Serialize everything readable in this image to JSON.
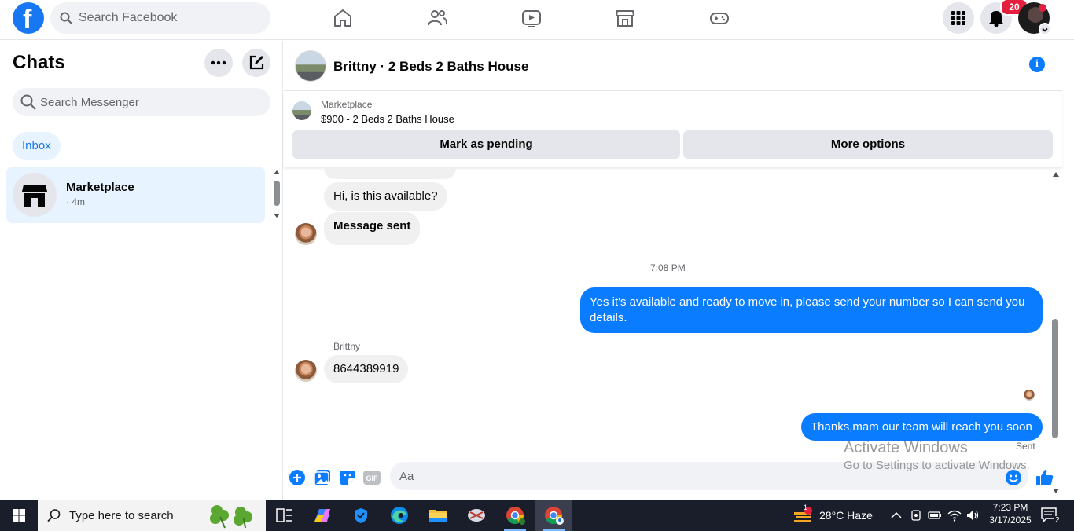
{
  "topbar": {
    "logo_letter": "f",
    "search_placeholder": "Search Facebook",
    "notifications_count": "20",
    "nav_icons": [
      "home-icon",
      "friends-icon",
      "watch-icon",
      "marketplace-icon",
      "gaming-icon"
    ]
  },
  "sidebar": {
    "title": "Chats",
    "search_placeholder": "Search Messenger",
    "filter_label": "Inbox",
    "conversations": [
      {
        "name": "Marketplace",
        "time": "· 4m"
      }
    ]
  },
  "conversation": {
    "title": "Brittny · 2 Beds 2 Baths House",
    "listing": {
      "category": "Marketplace",
      "price_title": "$900 - 2 Beds 2 Baths House",
      "pending_button": "Mark as pending",
      "more_button": "More options"
    },
    "messages": {
      "incoming_1": "Hi, is this available?",
      "incoming_2": "Message sent",
      "timestamp": "7:08 PM",
      "outgoing_1": "Yes it's available and ready to move in, please send your number so I can send you details.",
      "sender_name": "Brittny",
      "incoming_3": "8644389919",
      "outgoing_2": "Thanks,mam  our team will reach you soon",
      "status": "Sent"
    },
    "composer_placeholder": "Aa"
  },
  "watermark": {
    "line1": "Activate Windows",
    "line2": "Go to Settings to activate Windows."
  },
  "taskbar": {
    "search_placeholder": "Type here to search",
    "weather": "28°C  Haze",
    "weather_badge": "1",
    "time": "7:23 PM",
    "date": "3/17/2025",
    "notification_count": "2"
  },
  "colors": {
    "facebook_blue": "#1877f2",
    "messenger_blue": "#0a7cff",
    "badge_red": "#e41e3f",
    "taskbar_bg": "#1a1d2a"
  }
}
